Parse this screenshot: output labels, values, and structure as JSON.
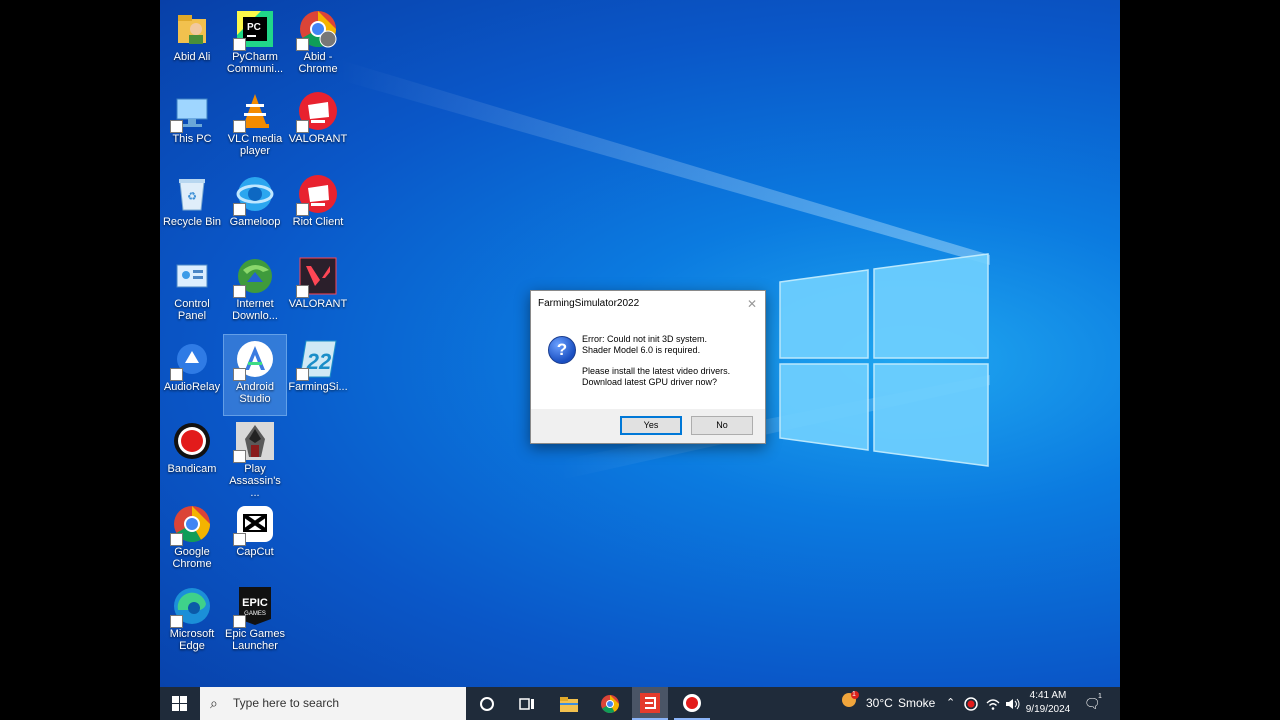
{
  "desktop": {
    "icons": [
      {
        "label": "Abid Ali",
        "icon": "user-folder-icon"
      },
      {
        "label": "PyCharm Communi...",
        "icon": "pycharm-icon"
      },
      {
        "label": "Abid - Chrome",
        "icon": "chrome-icon"
      },
      {
        "label": "This PC",
        "icon": "computer-icon"
      },
      {
        "label": "VLC media player",
        "icon": "vlc-icon"
      },
      {
        "label": "VALORANT",
        "icon": "riot-icon"
      },
      {
        "label": "Recycle Bin",
        "icon": "recycle-bin-icon"
      },
      {
        "label": "Gameloop",
        "icon": "gameloop-icon"
      },
      {
        "label": "Riot Client",
        "icon": "riot-icon"
      },
      {
        "label": "Control Panel",
        "icon": "control-panel-icon"
      },
      {
        "label": "Internet Downlo...",
        "icon": "idm-icon"
      },
      {
        "label": "VALORANT",
        "icon": "valorant-icon"
      },
      {
        "label": "AudioRelay",
        "icon": "audiorelay-icon"
      },
      {
        "label": "Android Studio",
        "icon": "android-studio-icon"
      },
      {
        "label": "FarmingSi...",
        "icon": "farming-simulator-icon"
      },
      {
        "label": "Bandicam",
        "icon": "bandicam-icon"
      },
      {
        "label": "Play Assassin's ...",
        "icon": "assassins-creed-icon"
      },
      {
        "label": "Google Chrome",
        "icon": "chrome-icon"
      },
      {
        "label": "CapCut",
        "icon": "capcut-icon"
      },
      {
        "label": "Microsoft Edge",
        "icon": "edge-icon"
      },
      {
        "label": "Epic Games Launcher",
        "icon": "epic-games-icon"
      }
    ]
  },
  "dialog": {
    "title": "FarmingSimulator2022",
    "close_glyph": "✕",
    "icon": "question-icon",
    "line1": "Error: Could not init 3D system.",
    "line2": "Shader Model 6.0 is required.",
    "line3": "Please install the latest video drivers.",
    "line4": "Download latest GPU driver now?",
    "yes_label": "Yes",
    "no_label": "No"
  },
  "taskbar": {
    "search_placeholder": "Type here to search",
    "weather_temp": "30°C",
    "weather_desc": "Smoke",
    "weather_badge": "1",
    "time": "4:41 AM",
    "date": "9/19/2024",
    "notification_glyph": "🗨",
    "notification_count": "1"
  },
  "colors": {
    "desktop": "#0b7be0",
    "taskbar": "#1f2b3a",
    "accent": "#0078d7"
  }
}
